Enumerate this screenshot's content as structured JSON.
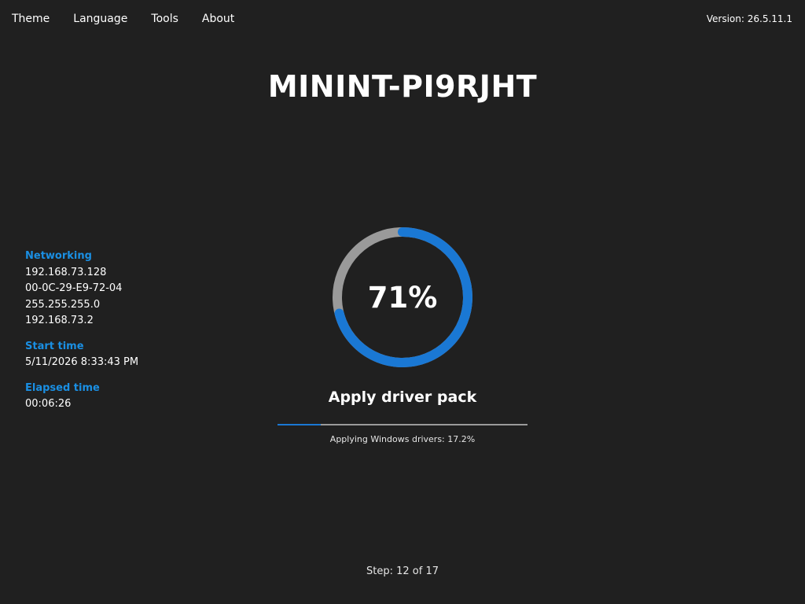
{
  "menu": {
    "items": [
      {
        "label": "Theme"
      },
      {
        "label": "Language"
      },
      {
        "label": "Tools"
      },
      {
        "label": "About"
      }
    ]
  },
  "version": "Version: 26.5.11.1",
  "computer_name": "MININT-PI9RJHT",
  "networking": {
    "heading": "Networking",
    "ip": "192.168.73.128",
    "mac": "00-0C-29-E9-72-04",
    "subnet": "255.255.255.0",
    "gateway": "192.168.73.2"
  },
  "start_time": {
    "heading": "Start time",
    "value": "5/11/2026 8:33:43 PM"
  },
  "elapsed_time": {
    "heading": "Elapsed time",
    "value": "00:06:26"
  },
  "progress": {
    "overall_percent_label": "71%",
    "overall_fraction": 0.71,
    "step_title": "Apply driver pack",
    "step_fraction": 0.172,
    "status_text": "Applying Windows drivers: 17.2%",
    "step_counter": "Step: 12 of 17"
  },
  "colors": {
    "background": "#202020",
    "accent": "#1a78d4",
    "ring_track": "#9a9a9a",
    "heading_blue": "#1a8fe3"
  }
}
